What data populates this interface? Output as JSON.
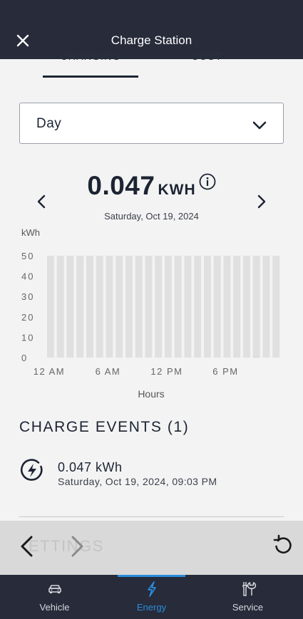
{
  "header": {
    "title": "Charge Station",
    "close_icon": "close-icon"
  },
  "tabs": [
    {
      "label": "CHARGING",
      "active": true
    },
    {
      "label": "COST",
      "active": false
    }
  ],
  "period_select": {
    "value": "Day"
  },
  "summary": {
    "value": "0.047",
    "unit": "KWH",
    "date": "Saturday, Oct 19, 2024"
  },
  "chart_data": {
    "type": "bar",
    "ylabel": "kWh",
    "xlabel": "Hours",
    "ylim": [
      0,
      50
    ],
    "y_ticks": [
      "50",
      "40",
      "30",
      "20",
      "10",
      "0"
    ],
    "x_ticks": [
      "12 AM",
      "6 AM",
      "12 PM",
      "6 PM"
    ],
    "categories": [
      "0",
      "1",
      "2",
      "3",
      "4",
      "5",
      "6",
      "7",
      "8",
      "9",
      "10",
      "11",
      "12",
      "13",
      "14",
      "15",
      "16",
      "17",
      "18",
      "19",
      "20",
      "21",
      "22",
      "23"
    ],
    "values": [
      0,
      0,
      0,
      0,
      0,
      0,
      0,
      0,
      0,
      0,
      0,
      0,
      0,
      0,
      0,
      0,
      0,
      0,
      0,
      0,
      0,
      0.047,
      0,
      0
    ],
    "background_bar_color": "#e0e0e0"
  },
  "events": {
    "title": "CHARGE EVENTS (1)",
    "items": [
      {
        "kwh": "0.047 kWh",
        "datetime": "Saturday, Oct 19, 2024, 09:03 PM"
      }
    ]
  },
  "settings_ghost": "ETTINGS",
  "bottom_nav": [
    {
      "label": "Vehicle",
      "icon": "car-icon",
      "active": false
    },
    {
      "label": "Energy",
      "icon": "lightning-icon",
      "active": true
    },
    {
      "label": "Service",
      "icon": "tools-icon",
      "active": false
    }
  ],
  "colors": {
    "header_bg": "#272b3a",
    "accent": "#2a8cdb",
    "text_dark": "#1c2433"
  }
}
